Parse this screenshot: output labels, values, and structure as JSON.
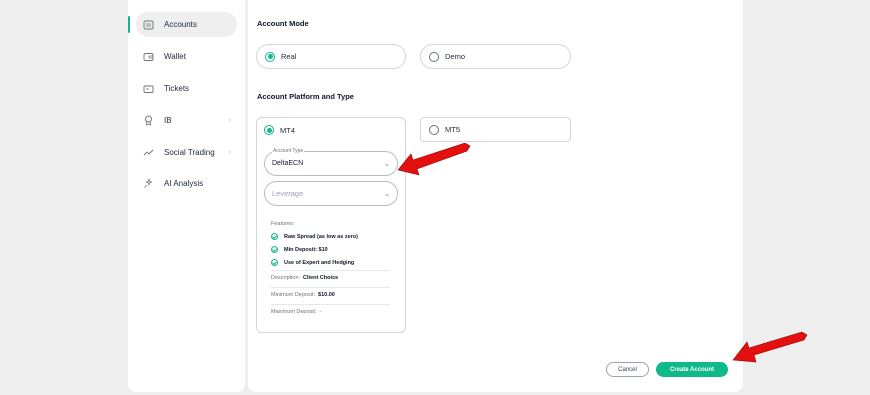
{
  "sidebar": {
    "items": [
      {
        "label": "Accounts",
        "icon": "accounts-icon",
        "active": true,
        "has_chevron": false
      },
      {
        "label": "Wallet",
        "icon": "wallet-icon",
        "active": false,
        "has_chevron": false
      },
      {
        "label": "Tickets",
        "icon": "ticket-icon",
        "active": false,
        "has_chevron": false
      },
      {
        "label": "IB",
        "icon": "award-icon",
        "active": false,
        "has_chevron": true
      },
      {
        "label": "Social Trading",
        "icon": "trend-icon",
        "active": false,
        "has_chevron": true
      },
      {
        "label": "AI Analysis",
        "icon": "sparkle-icon",
        "active": false,
        "has_chevron": false
      }
    ]
  },
  "main": {
    "account_mode": {
      "title": "Account Mode",
      "options": [
        {
          "label": "Real",
          "selected": true
        },
        {
          "label": "Demo",
          "selected": false
        }
      ]
    },
    "platform": {
      "title": "Account Platform and Type",
      "options": [
        {
          "label": "MT4",
          "selected": true
        },
        {
          "label": "MT5",
          "selected": false
        }
      ],
      "account_type": {
        "label": "Account Type",
        "value": "DeltaECN"
      },
      "leverage": {
        "placeholder": "Leverage"
      },
      "features_title": "Features:",
      "features": [
        "Raw Spread (as low as zero)",
        "Min Deposit: $10",
        "Use of Expert and Hedging"
      ],
      "description": {
        "label": "Description:",
        "value": "Client Choice"
      },
      "minimum_deposit": {
        "label": "Minimum Deposit:",
        "value": "$10.00"
      },
      "maximum_deposit": {
        "label": "Maximum Deposit:",
        "value": "-"
      }
    },
    "buttons": {
      "cancel": "Cancel",
      "create": "Create Account"
    }
  },
  "colors": {
    "accent": "#10b98a",
    "annotation_arrow": "#e3100f"
  }
}
